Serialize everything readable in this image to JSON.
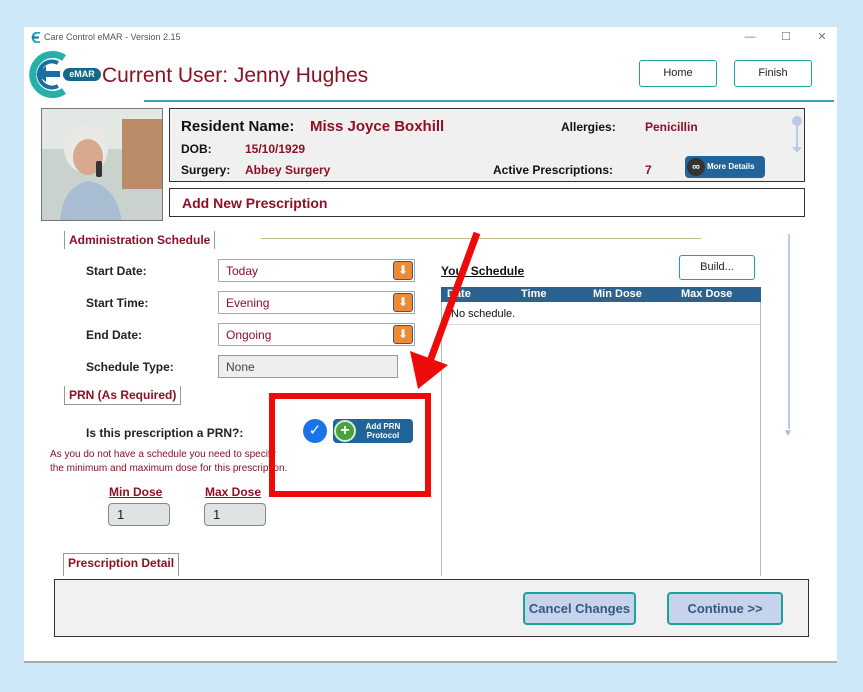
{
  "window": {
    "title": "Care Control eMAR - Version 2.15",
    "minimize": "—",
    "maximize": "☐",
    "close": "✕"
  },
  "header": {
    "logo_badge": "eMAR",
    "current_user": "Current User: Jenny Hughes",
    "home_label": "Home",
    "finish_label": "Finish"
  },
  "resident": {
    "name_label": "Resident Name:",
    "name_value": "Miss Joyce Boxhill",
    "dob_label": "DOB:",
    "dob_value": "15/10/1929",
    "surgery_label": "Surgery:",
    "surgery_value": "Abbey Surgery",
    "allergies_label": "Allergies:",
    "allergies_value": "Penicillin",
    "active_rx_label": "Active Prescriptions:",
    "active_rx_value": "7",
    "more_details_label": "More Details"
  },
  "section_title": "Add New Prescription",
  "admin_schedule": {
    "title": "Administration Schedule",
    "start_date_label": "Start Date:",
    "start_date_value": "Today",
    "start_time_label": "Start Time:",
    "start_time_value": "Evening",
    "end_date_label": "End Date:",
    "end_date_value": "Ongoing",
    "schedule_type_label": "Schedule Type:",
    "schedule_type_value": "None"
  },
  "your_schedule": {
    "title": "Your Schedule",
    "build_label": "Build...",
    "columns": [
      "Date",
      "Time",
      "Min Dose",
      "Max Dose"
    ],
    "empty_text": "No schedule."
  },
  "prn": {
    "title": "PRN (As Required)",
    "question": "Is this prescription a PRN?:",
    "add_protocol_line1": "Add PRN",
    "add_protocol_line2": "Protocol",
    "note_line1": "As you do not have a schedule you need to specify",
    "note_line2": "the minimum and maximum dose for this prescription.",
    "min_dose_label": "Min Dose",
    "min_dose_value": "1",
    "max_dose_label": "Max Dose",
    "max_dose_value": "1"
  },
  "prescription_detail": {
    "title": "Prescription Detail"
  },
  "footer": {
    "cancel_label": "Cancel Changes",
    "continue_label": "Continue >>"
  },
  "colors": {
    "accent_red": "#8d1026",
    "teal_border": "#1ba39c",
    "grid_header": "#2b628f",
    "annotation_red": "#ef0a0a"
  }
}
